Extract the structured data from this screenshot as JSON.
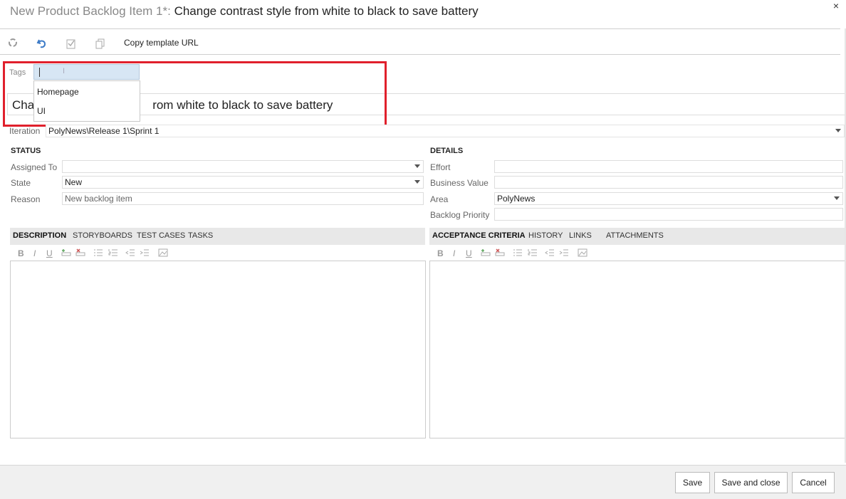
{
  "header": {
    "prefix": "New Product Backlog Item 1*:",
    "title": "Change contrast style from white to black to save battery",
    "close_label": "×"
  },
  "toolbar": {
    "refresh_icon": "refresh-icon",
    "undo_icon": "undo-icon",
    "attach_icon": "clipboard-icon",
    "copy_icon": "copy-icon",
    "copy_template_label": "Copy template URL"
  },
  "tags": {
    "label": "Tags",
    "input_value": "",
    "suggestions": [
      "Homepage",
      "UI"
    ]
  },
  "title_field": {
    "visible_start": "Cha",
    "visible_end": "rom white to black to save battery"
  },
  "iteration": {
    "label": "Iteration",
    "value": "PolyNews\\Release 1\\Sprint 1"
  },
  "status": {
    "heading": "STATUS",
    "assigned_to_label": "Assigned To",
    "assigned_to_value": "",
    "state_label": "State",
    "state_value": "New",
    "reason_label": "Reason",
    "reason_value": "New backlog item"
  },
  "details": {
    "heading": "DETAILS",
    "effort_label": "Effort",
    "effort_value": "",
    "business_value_label": "Business Value",
    "business_value_value": "",
    "area_label": "Area",
    "area_value": "PolyNews",
    "backlog_priority_label": "Backlog Priority",
    "backlog_priority_value": ""
  },
  "left_tabs": [
    "DESCRIPTION",
    "STORYBOARDS",
    "TEST CASES",
    "TASKS"
  ],
  "right_tabs": [
    "ACCEPTANCE CRITERIA",
    "HISTORY",
    "LINKS",
    "ATTACHMENTS"
  ],
  "format": {
    "bold": "B",
    "italic": "I",
    "underline": "U"
  },
  "footer": {
    "save": "Save",
    "save_close": "Save and close",
    "cancel": "Cancel"
  },
  "colors": {
    "highlight": "#e0202c",
    "tags_focus": "#d7e6f4"
  }
}
